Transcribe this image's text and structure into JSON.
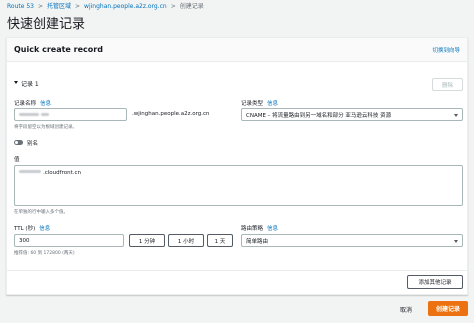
{
  "breadcrumb": {
    "items": [
      "Route 53",
      "托管区域",
      "wjinghan.people.a2z.org.cn",
      "创建记录"
    ],
    "separator": ">"
  },
  "page_title": "快速创建记录",
  "panel": {
    "title": "Quick create record",
    "switch_link": "切换到向导",
    "record_header": "记录 1",
    "delete_button": "删除",
    "record_name": {
      "label": "记录名称",
      "info": "信息",
      "value": "",
      "suffix": ".wjinghan.people.a2z.org.cn",
      "hint": "将字段留空以为根域创建记录。"
    },
    "record_type": {
      "label": "记录类型",
      "info": "信息",
      "value": "CNAME – 将流量路由到另一域名和部分 亚马逊云科技 资源"
    },
    "alias": {
      "label": "别名",
      "enabled": false
    },
    "value": {
      "label": "值",
      "content": ".cloudfront.cn",
      "hint": "在单独的行中输入多个值。"
    },
    "ttl": {
      "label": "TTL (秒)",
      "info": "信息",
      "value": "300",
      "hint": "推荐值: 60 到 172800 (两天)",
      "presets": [
        "1 分钟",
        "1 小时",
        "1 天"
      ]
    },
    "routing_policy": {
      "label": "路由策略",
      "info": "信息",
      "value": "简单路由"
    },
    "add_record_button": "添加其他记录"
  },
  "footer": {
    "cancel": "取消",
    "create": "创建记录"
  },
  "colors": {
    "link": "#0073bb",
    "primary": "#ec7211",
    "background": "#f2f3f3"
  }
}
